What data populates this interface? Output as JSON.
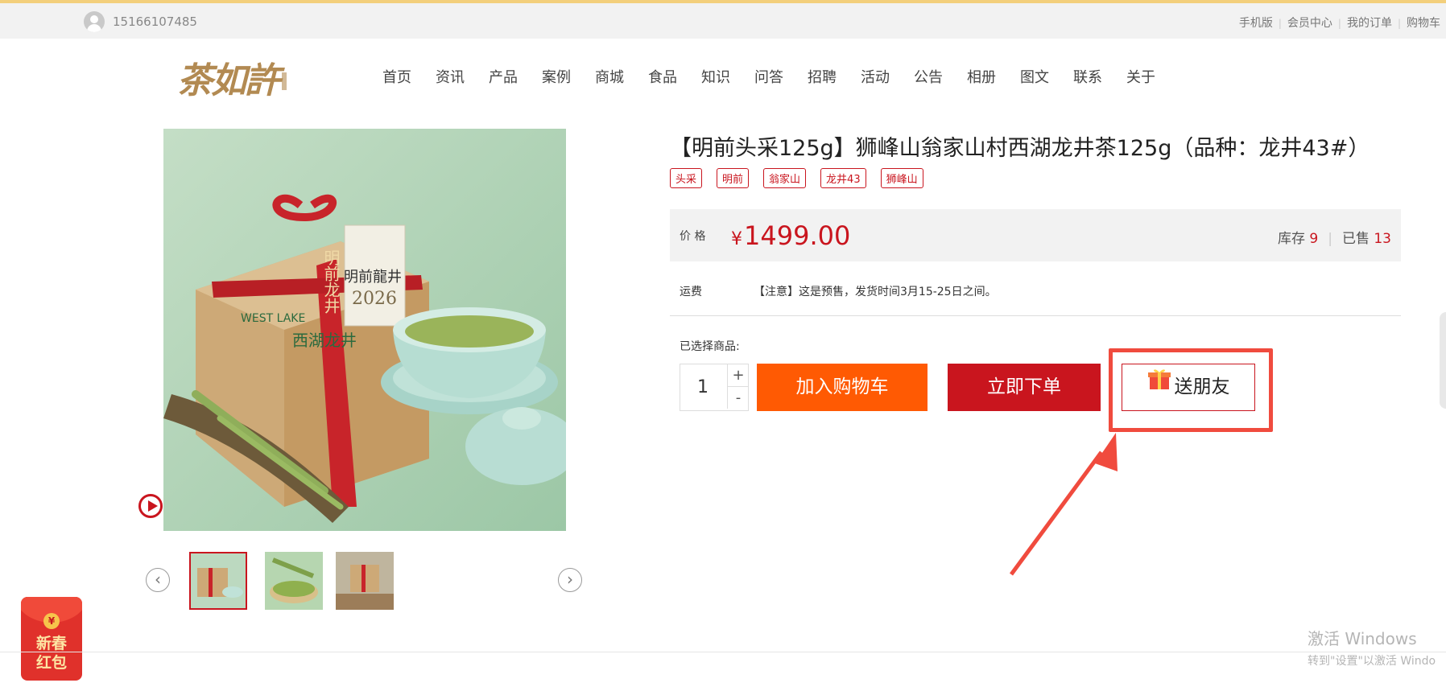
{
  "topbar": {
    "phone": "15166107485",
    "links": [
      "手机版",
      "会员中心",
      "我的订单",
      "购物车"
    ]
  },
  "brand": {
    "logo_text": "茶如許"
  },
  "nav": [
    "首页",
    "资讯",
    "产品",
    "案例",
    "商城",
    "食品",
    "知识",
    "问答",
    "招聘",
    "活动",
    "公告",
    "相册",
    "图文",
    "联系",
    "关于"
  ],
  "product": {
    "title": "【明前头采125g】狮峰山翁家山村西湖龙井茶125g（品种：龙井43#）",
    "tags": [
      "头采",
      "明前",
      "翁家山",
      "龙井43",
      "狮峰山"
    ],
    "price_label": "价 格",
    "currency": "¥",
    "price": "1499.00",
    "stock_label": "库存",
    "stock": "9",
    "sold_label": "已售",
    "sold": "13",
    "shipping_label": "运费",
    "shipping_note": "【注意】这是预售，发货时间3月15-25日之间。",
    "selected_label": "已选择商品:",
    "quantity": "1",
    "image_print": {
      "band_text": "明前龙井",
      "label_text": "明前龍井",
      "year": "2026",
      "box_text": "西湖龙井",
      "box_en": "WEST LAKE"
    }
  },
  "buttons": {
    "plus": "+",
    "minus": "-",
    "add_cart": "加入购物车",
    "buy_now": "立即下单",
    "gift": "送朋友"
  },
  "promo": {
    "coin": "¥",
    "line1": "新春",
    "line2": "红包"
  },
  "watermark": {
    "line1": "激活 Windows",
    "line2": "转到\"设置\"以激活 Windo"
  },
  "colors": {
    "accent_red": "#c9151e",
    "cart_orange": "#ff5a03",
    "highlight": "#f04b3e",
    "top_stripe": "#f3cf7c",
    "brand_gold": "#b28a52"
  }
}
